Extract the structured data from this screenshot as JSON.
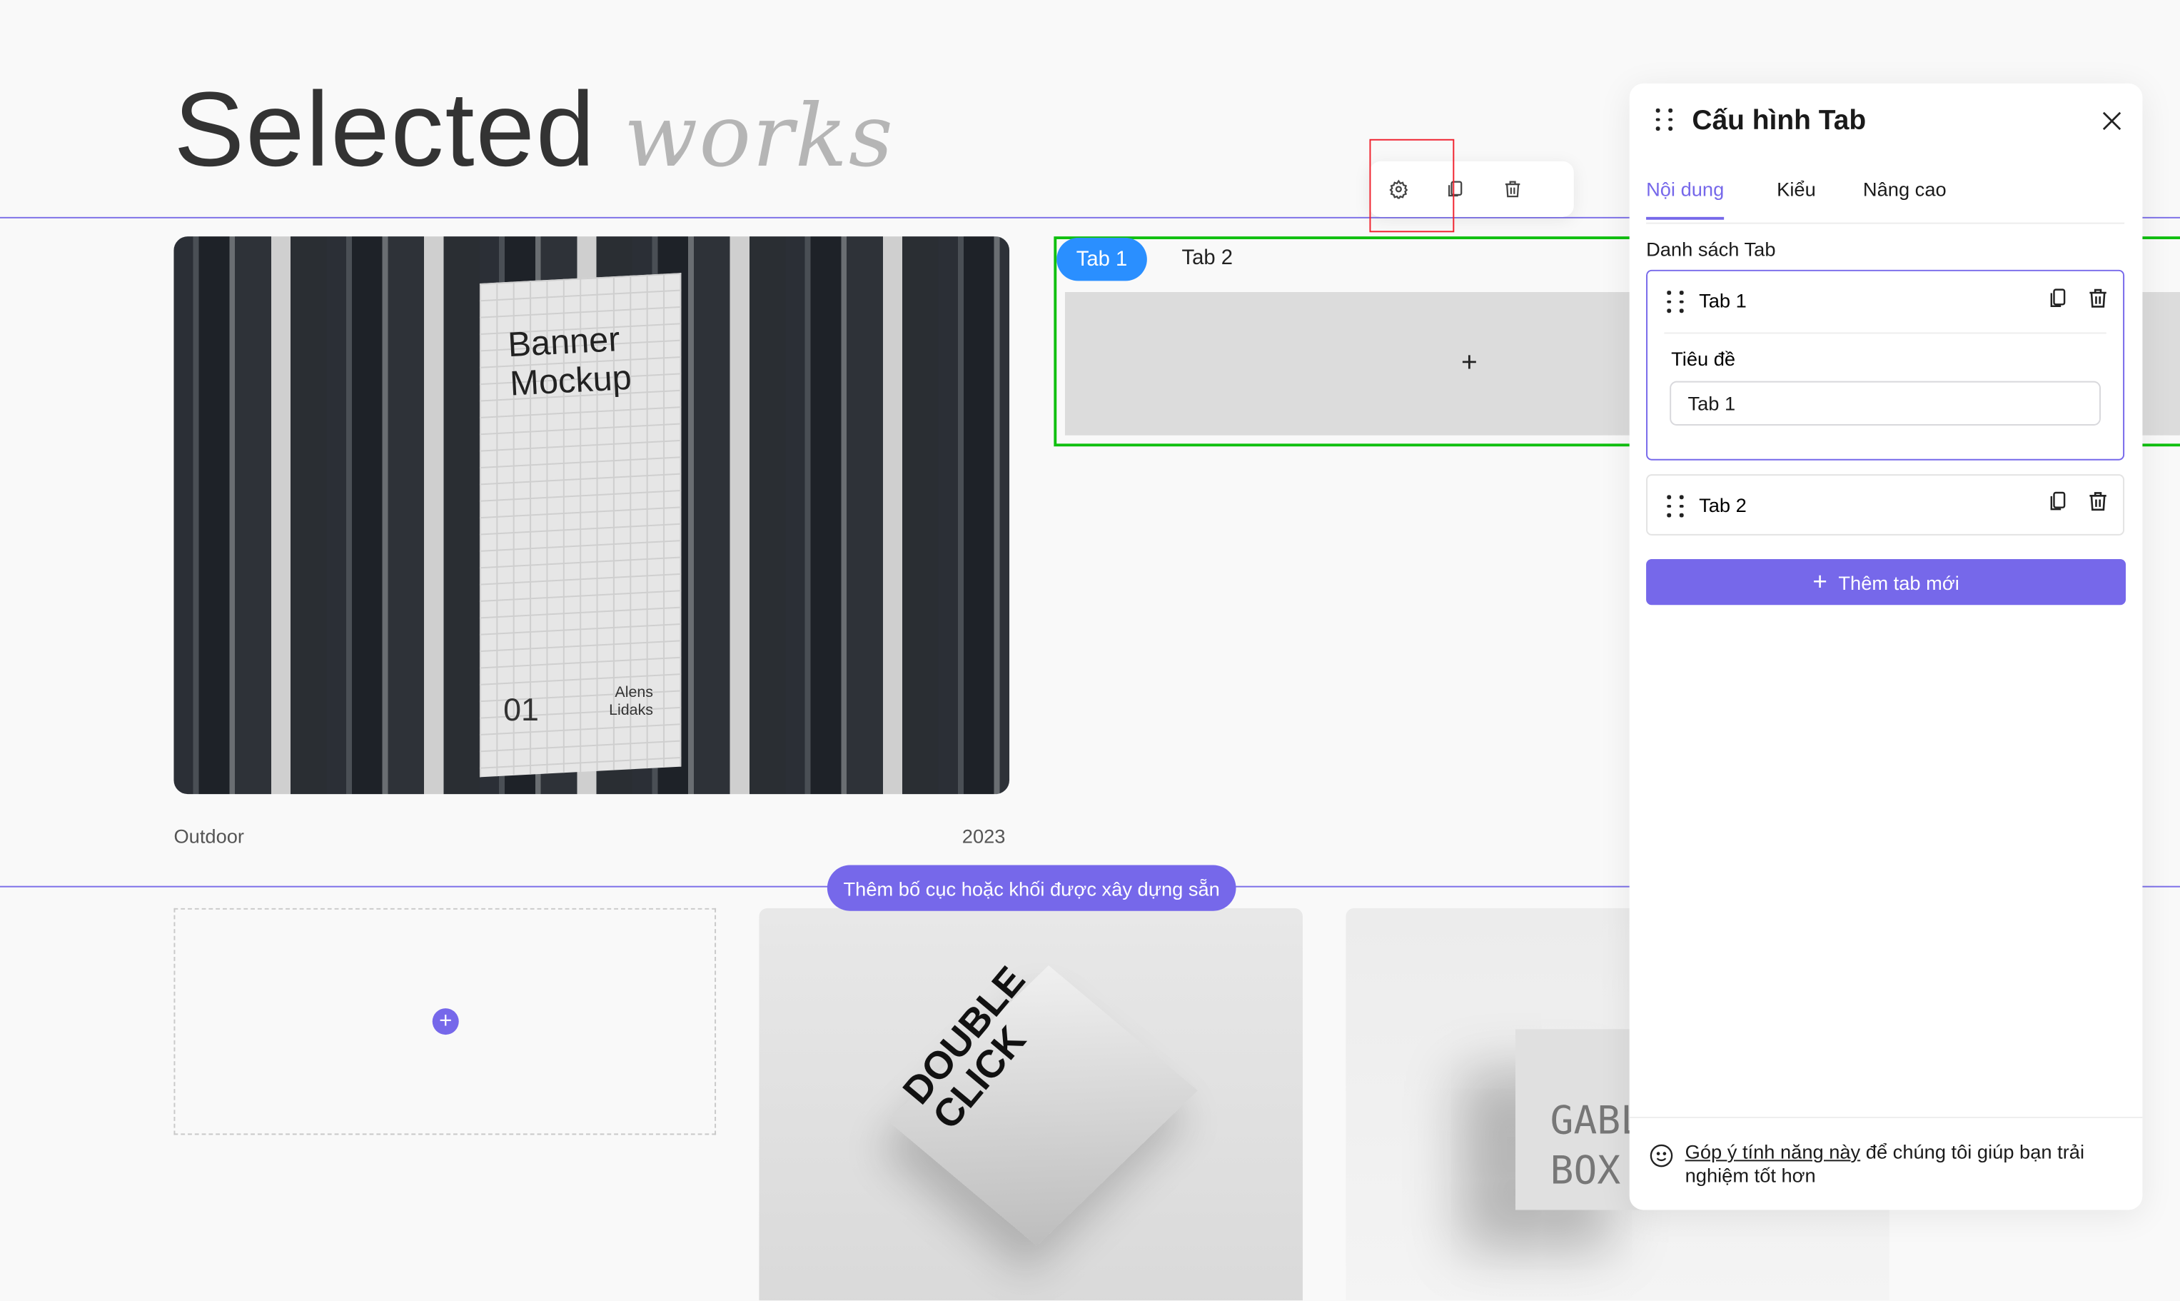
{
  "page": {
    "title_main": "Selected",
    "title_accent": "works",
    "accent_color": "#7668ea",
    "project": {
      "image_title_line1": "Banner",
      "image_title_line2": "Mockup",
      "image_number": "01",
      "image_author_line1": "Alens",
      "image_author_line2": "Lidaks",
      "category": "Outdoor",
      "year": "2023"
    },
    "add_layout_label": "Thêm bố cục hoặc khối được xây dựng sẵn",
    "card2_text_line1": "DOUBLE",
    "card2_text_line2": "CLICK",
    "card3_text_line1": "GABLE",
    "card3_text_line2": "BOX"
  },
  "toolbar": {
    "icons": [
      "gear-icon",
      "copy-icon",
      "trash-icon"
    ]
  },
  "tabs_widget": {
    "tabs": [
      {
        "label": "Tab 1",
        "active": true
      },
      {
        "label": "Tab 2",
        "active": false
      }
    ],
    "add_symbol": "+",
    "active_color": "#2a8fff"
  },
  "panel": {
    "title": "Cấu hình Tab",
    "tabs": [
      {
        "label": "Nội dung",
        "active": true
      },
      {
        "label": "Kiểu"
      },
      {
        "label": "Nâng cao"
      }
    ],
    "list_label": "Danh sách Tab",
    "items": [
      {
        "label": "Tab 1",
        "expanded": true,
        "field_label": "Tiêu đề",
        "field_value": "Tab 1"
      },
      {
        "label": "Tab 2",
        "expanded": false
      }
    ],
    "add_button": "Thêm tab mới",
    "feedback_link": "Góp ý tính năng này",
    "feedback_text": " để chúng tôi giúp bạn trải nghiệm tốt hơn"
  }
}
